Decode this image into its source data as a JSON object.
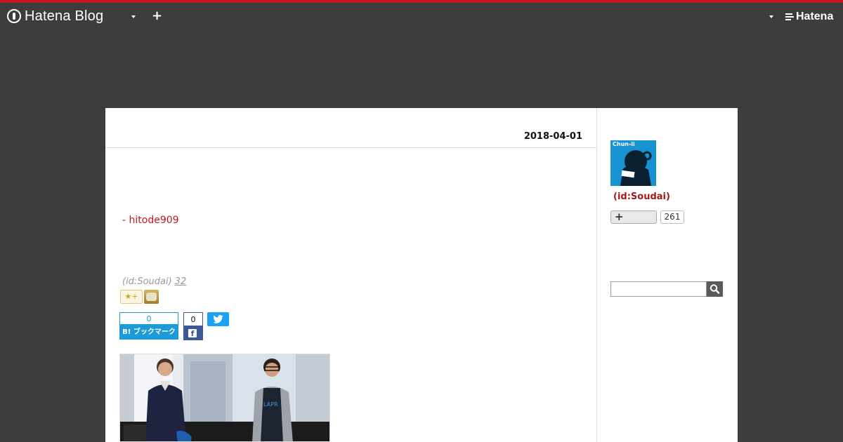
{
  "topbar": {
    "brand": "Hatena Blog",
    "add_label": "+",
    "right_brand": "Hatena"
  },
  "entry": {
    "date": "2018-04-01",
    "link_text": "- hitode909",
    "author_id": "(id:Soudai)",
    "author_count": "32",
    "star_add": "★+",
    "bookmark_count": "0",
    "bookmark_label": "B! ブックマーク",
    "facebook_count": "0",
    "facebook_glyph": "f"
  },
  "sidebar": {
    "avatar_text": "Chun-li",
    "profile_id": "(id:Soudai)",
    "subscribe_label": "+",
    "subscribe_count": "261",
    "search_placeholder": ""
  },
  "colors": {
    "accent_red": "#c8141b",
    "header_bg": "#3d3d3d",
    "hatena_bookmark_blue": "#1d9bd8",
    "facebook_blue": "#3b5998",
    "twitter_blue": "#1da1f2"
  },
  "icons": [
    "hatena-logo-icon",
    "chevron-down-icon",
    "plus-icon",
    "twitter-icon",
    "facebook-icon",
    "search-icon"
  ]
}
